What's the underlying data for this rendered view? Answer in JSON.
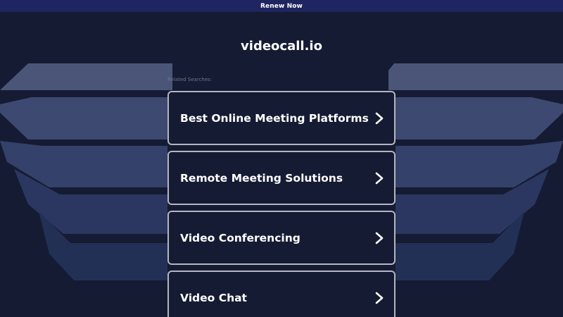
{
  "banner": {
    "renew_label": "Renew Now"
  },
  "header": {
    "domain": "videocall.io"
  },
  "related": {
    "label": "Related Searches:",
    "items": [
      {
        "label": "Best Online Meeting Platforms"
      },
      {
        "label": "Remote Meeting Solutions"
      },
      {
        "label": "Video Conferencing"
      },
      {
        "label": "Video Chat"
      }
    ]
  },
  "colors": {
    "background": "#151b33",
    "banner": "#1e2560",
    "card_border": "#b4b6bf",
    "text": "#ffffff"
  },
  "icons": {
    "item_arrow": "chevron-right-icon"
  }
}
